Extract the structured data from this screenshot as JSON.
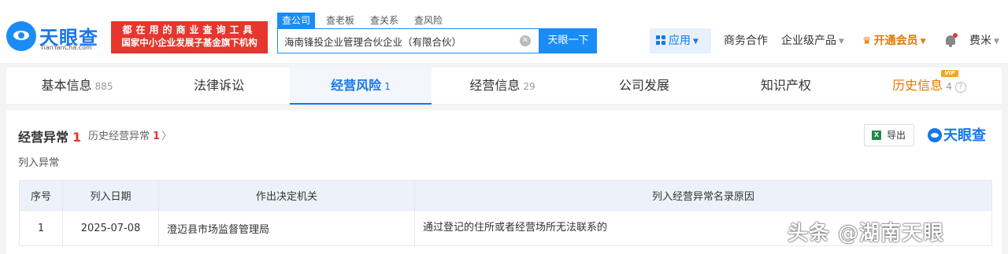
{
  "header": {
    "logo": {
      "brand": "天眼查",
      "domain": "TianYanCha.com"
    },
    "badge": {
      "line1": "都在用的商业查询工具",
      "line2": "国家中小企业发展子基金旗下机构"
    },
    "search_tabs": [
      "查公司",
      "查老板",
      "查关系",
      "查风险"
    ],
    "search_value": "海南锋投企业管理合伙企业（有限合伙）",
    "search_button": "天眼一下",
    "nav": {
      "app": "应用",
      "business": "商务合作",
      "products": "企业级产品",
      "vip": "开通会员",
      "user": "费米"
    }
  },
  "tabs": [
    {
      "label": "基本信息",
      "count": "885"
    },
    {
      "label": "法律诉讼",
      "count": ""
    },
    {
      "label": "经营风险",
      "count": "1"
    },
    {
      "label": "经营信息",
      "count": "29"
    },
    {
      "label": "公司发展",
      "count": ""
    },
    {
      "label": "知识产权",
      "count": ""
    },
    {
      "label": "历史信息",
      "count": "4"
    }
  ],
  "vip_tag": "VIP",
  "section": {
    "title": "经营异常",
    "count": "1",
    "history_label": "历史经营异常",
    "history_count": "1",
    "export_label": "导出",
    "brand": "天眼查",
    "subheading": "列入异常"
  },
  "table": {
    "headers": [
      "序号",
      "列入日期",
      "作出决定机关",
      "列入经营异常名录原因"
    ],
    "rows": [
      {
        "index": "1",
        "date": "2025-07-08",
        "authority": "澄迈县市场监督管理局",
        "reason": "通过登记的住所或者经营场所无法联系的"
      }
    ]
  },
  "watermark": "头条 @湖南天眼"
}
